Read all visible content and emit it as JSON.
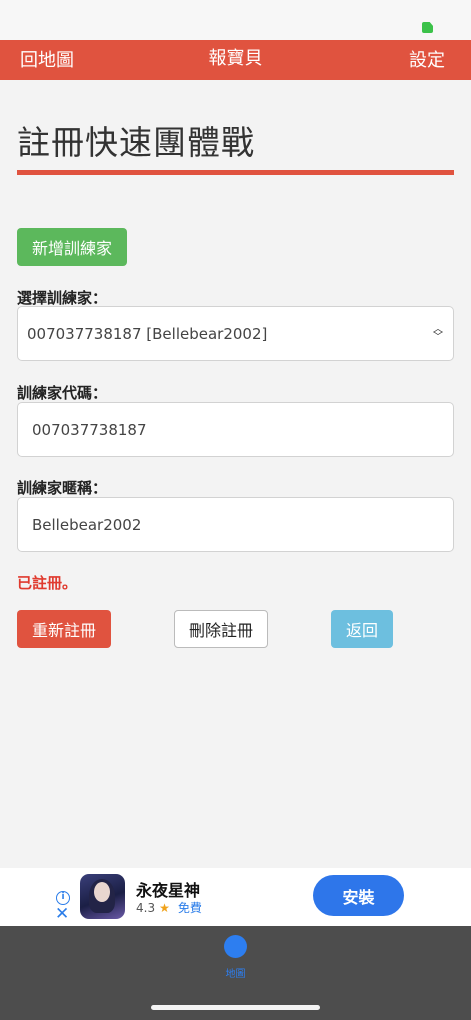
{
  "navbar": {
    "back_label": "回地圖",
    "title": "報寶貝",
    "settings_label": "設定"
  },
  "page": {
    "title": "註冊快速團體戰"
  },
  "form": {
    "add_trainer_label": "新增訓練家",
    "select_label": "選擇訓練家：",
    "select_value": "007037738187 [Bellebear2002]",
    "code_label": "訓練家代碼：",
    "code_value": "007037738187",
    "nickname_label": "訓練家暱稱：",
    "nickname_value": "Bellebear2002",
    "status": "已註冊。",
    "reregister_label": "重新註冊",
    "delete_label": "刪除註冊",
    "back_label": "返回"
  },
  "ad": {
    "info_icon": "i",
    "close_icon": "✕",
    "app_name": "永夜星神",
    "rating": "4.3",
    "star_icon": "★",
    "price": "免費",
    "install_label": "安裝"
  },
  "tabbar": {
    "map_label": "地圖"
  },
  "colors": {
    "accent": "#e0533f",
    "success": "#5cb85c",
    "info": "#6dbfdf",
    "status_text": "#e03a2e",
    "ad_button": "#2e76ea"
  }
}
